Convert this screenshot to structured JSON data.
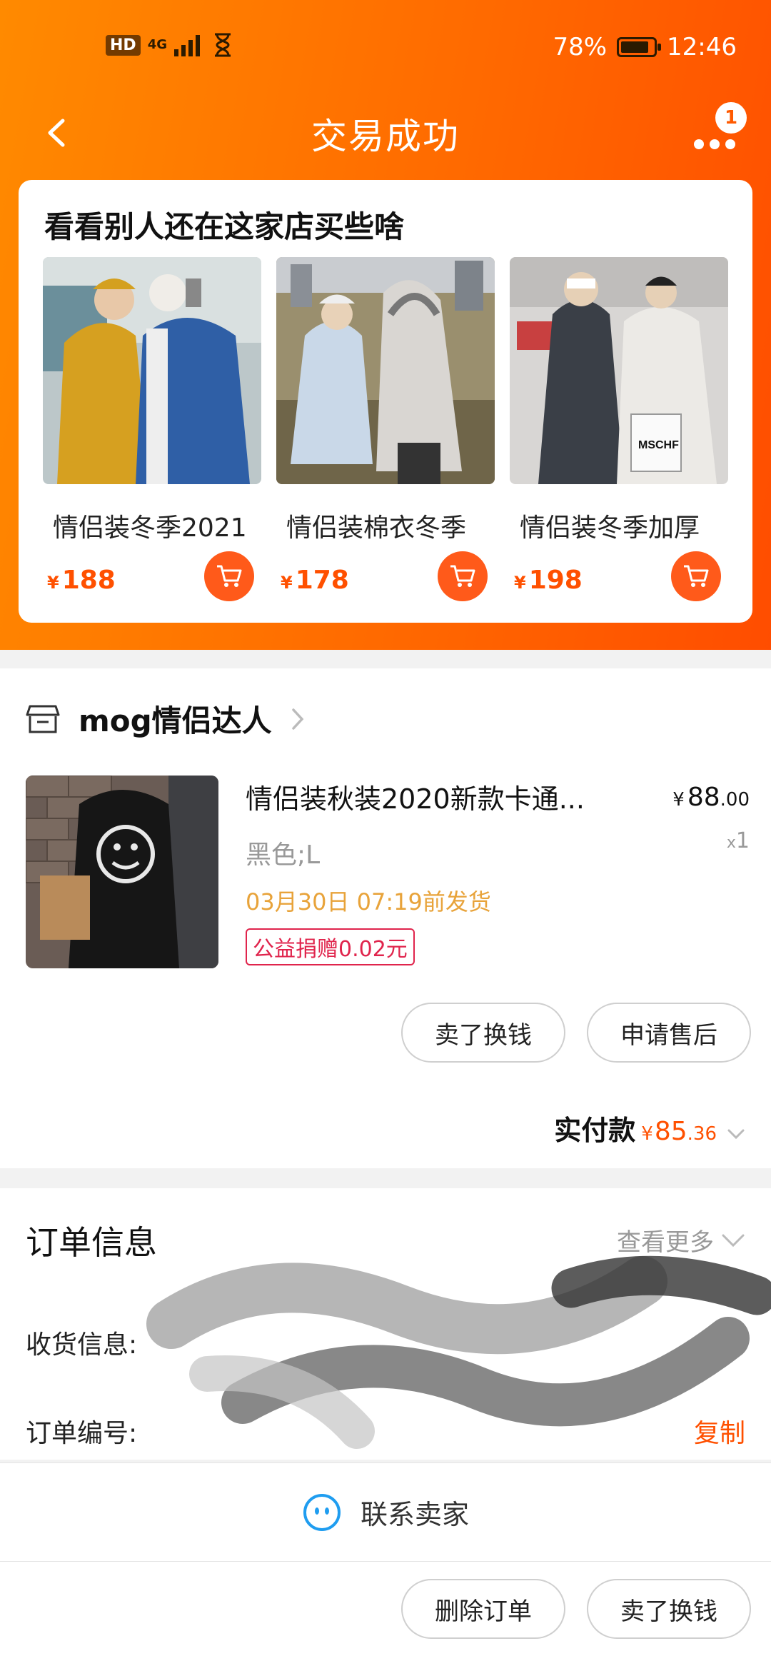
{
  "status_bar": {
    "hd": "HD",
    "net_top": "4G",
    "net_bottom": "4G",
    "battery": "78%",
    "time": "12:46"
  },
  "header": {
    "title": "交易成功",
    "badge_count": "1"
  },
  "recommend": {
    "title": "看看别人还在这家店买些啥",
    "items": [
      {
        "name": "情侣装冬季2021",
        "currency": "¥",
        "price": "188"
      },
      {
        "name": "情侣装棉衣冬季",
        "currency": "¥",
        "price": "178"
      },
      {
        "name": "情侣装冬季加厚",
        "currency": "¥",
        "price": "198"
      }
    ],
    "mschf_label": "MSCHF"
  },
  "shop": {
    "name": "mog情侣达人",
    "product": {
      "title": "情侣装秋装2020新款卡通...",
      "currency": "¥",
      "price_int": "88",
      "price_dec": ".00",
      "qty_prefix": "x",
      "qty": "1",
      "sku": "黑色;L",
      "ship": "03月30日 07:19前发货",
      "charity": "公益捐赠0.02元"
    },
    "actions": {
      "sell": "卖了换钱",
      "after_sale": "申请售后"
    },
    "paid": {
      "label": "实付款",
      "currency": "¥",
      "amount_int": "85",
      "amount_dec": ".36"
    }
  },
  "order": {
    "title": "订单信息",
    "see_more": "查看更多",
    "address_label": "收货信息:",
    "order_no_label": "订单编号:",
    "copy": "复制"
  },
  "contact": {
    "label": "联系卖家"
  },
  "bottom": {
    "delete": "删除订单",
    "sell": "卖了换钱"
  },
  "colors": {
    "accent": "#ff5000",
    "gradient_start": "#ff8a00",
    "gradient_end": "#ff4d00",
    "ship": "#e8a33a",
    "charity": "#e0244c"
  }
}
